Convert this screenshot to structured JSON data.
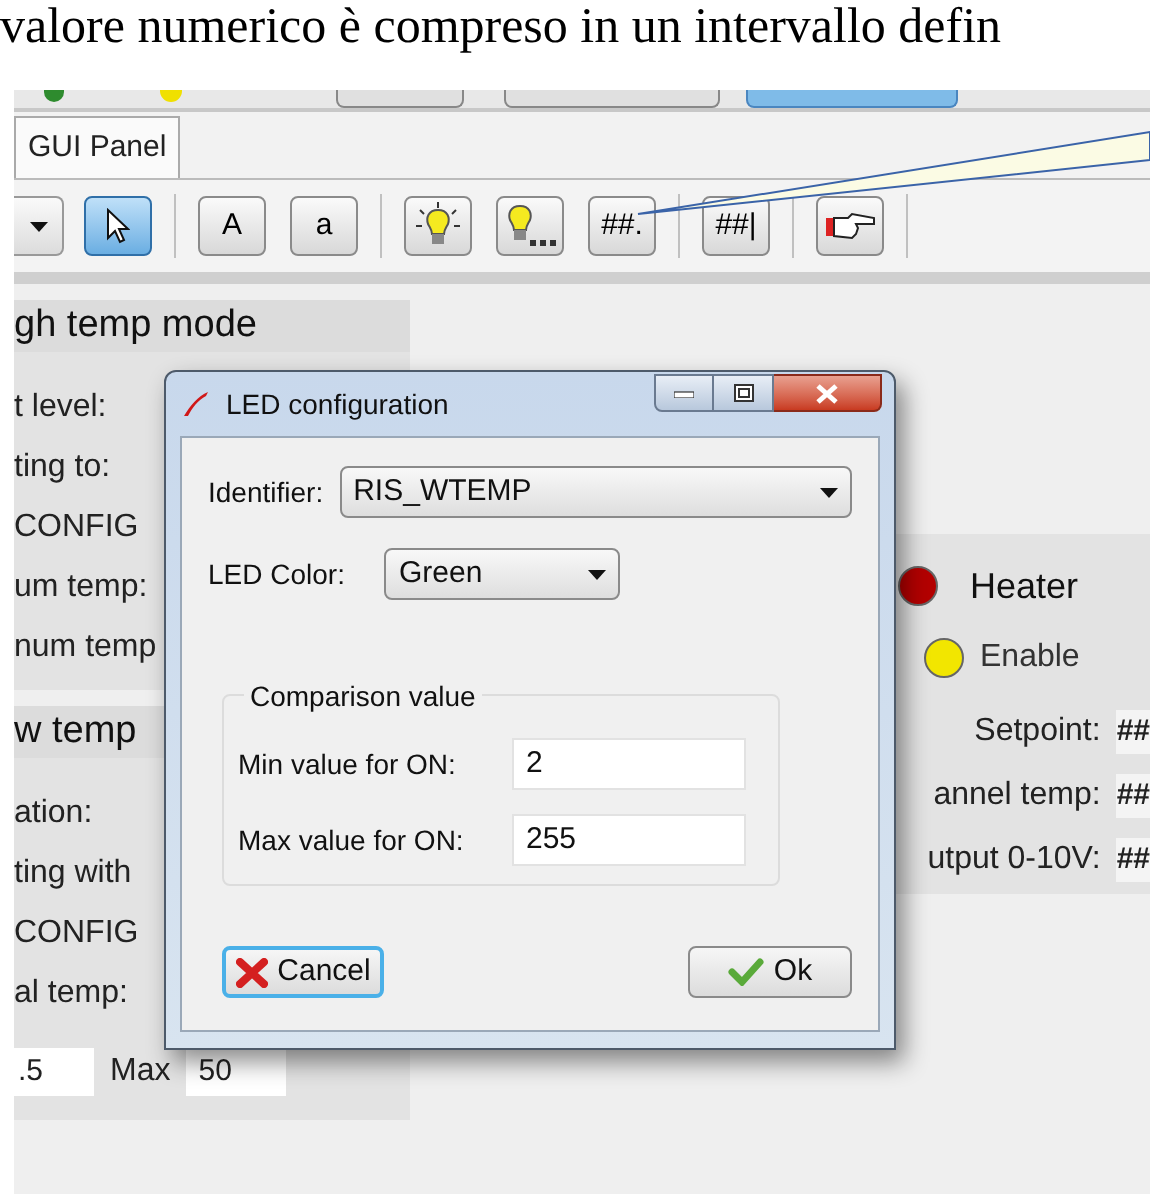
{
  "document_text": "valore numerico è compreso in un intervallo defin",
  "tabs": [
    {
      "label": "GUI Panel",
      "selected": true
    }
  ],
  "toolbar": [
    {
      "kind": "dropdown"
    },
    {
      "kind": "pointer",
      "selected": true
    },
    {
      "kind": "separator"
    },
    {
      "kind": "text",
      "label": "A",
      "selected": false
    },
    {
      "kind": "text",
      "label": "a",
      "selected": false
    },
    {
      "kind": "separator"
    },
    {
      "kind": "bulb",
      "selected": false
    },
    {
      "kind": "bulb-dots",
      "selected": false
    },
    {
      "kind": "text",
      "label": "##.",
      "selected": false
    },
    {
      "kind": "separator"
    },
    {
      "kind": "text",
      "label": "##|",
      "selected": false
    },
    {
      "kind": "separator"
    },
    {
      "kind": "hand",
      "selected": false
    },
    {
      "kind": "separator"
    }
  ],
  "left_panel": [
    {
      "title": "gh temp mode",
      "rows": [
        "t level:",
        "ting to:",
        "CONFIG",
        "um temp:",
        "num temp"
      ]
    },
    {
      "title": "w temp",
      "rows": [
        "ation:",
        "ting with",
        "CONFIG",
        "al temp:"
      ],
      "range": {
        "min": ".5",
        "max_label": "Max",
        "max": "50"
      }
    }
  ],
  "right_panel": {
    "leds": [
      {
        "kind": "title",
        "label": "Heater",
        "color": "#b30000"
      },
      {
        "kind": "option",
        "label": "Enable",
        "color": "#f2e600"
      }
    ],
    "readings": [
      {
        "label": "Setpoint:",
        "value": "##"
      },
      {
        "label": "annel temp:",
        "value": "##"
      },
      {
        "label": "utput 0-10V:",
        "value": "##"
      }
    ]
  },
  "dialog": {
    "title": "LED configuration",
    "fields": [
      {
        "label": "Identifier:",
        "value": "RIS_WTEMP"
      },
      {
        "label": "LED Color:",
        "value": "Green"
      }
    ],
    "group": {
      "title": "Comparison value",
      "fields": [
        {
          "label": "Min value for ON:",
          "value": "2"
        },
        {
          "label": "Max value for ON:",
          "value": "255"
        }
      ]
    },
    "buttons": [
      {
        "kind": "cancel",
        "label": "Cancel",
        "focused": true
      },
      {
        "kind": "ok",
        "label": "Ok",
        "focused": false
      }
    ]
  }
}
